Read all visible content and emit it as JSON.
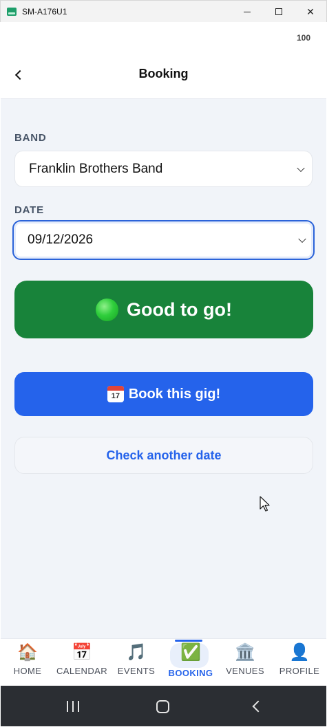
{
  "window": {
    "title": "SM-A176U1",
    "minimize_icon": "minimize-icon",
    "maximize_icon": "maximize-icon",
    "close_glyph": "✕"
  },
  "status": {
    "battery": "100"
  },
  "header": {
    "title": "Booking",
    "back_icon": "chevron-left-icon"
  },
  "form": {
    "band_label": "BAND",
    "band_value": "Franklin Brothers Band",
    "date_label": "DATE",
    "date_value": "09/12/2026"
  },
  "status_banner": {
    "text": "Good to go!",
    "icon": "green-circle-icon",
    "color": "#18833a"
  },
  "actions": {
    "book_label": "Book this gig!",
    "book_icon": "calendar-icon",
    "calendar_icon_day": "17",
    "check_label": "Check another date"
  },
  "nav": {
    "items": [
      {
        "label": "HOME",
        "icon": "🏠"
      },
      {
        "label": "CALENDAR",
        "icon": "📅"
      },
      {
        "label": "EVENTS",
        "icon": "🎵"
      },
      {
        "label": "BOOKING",
        "icon": "✅"
      },
      {
        "label": "VENUES",
        "icon": "🏛️"
      },
      {
        "label": "PROFILE",
        "icon": "👤"
      }
    ],
    "active": "BOOKING"
  },
  "colors": {
    "accent": "#2563eb",
    "success": "#18833a",
    "background": "#f1f4f9"
  }
}
